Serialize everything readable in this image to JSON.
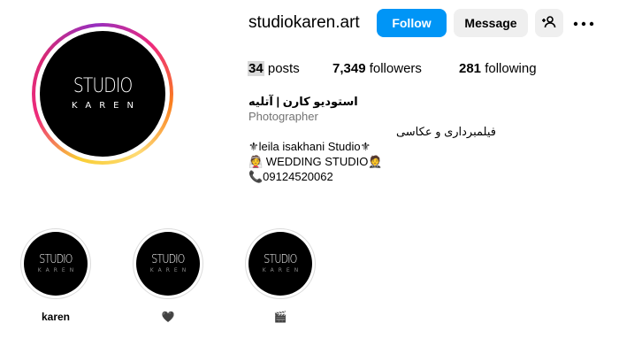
{
  "profile": {
    "username": "studiokaren.art",
    "avatar_logo_main": "STUDIO",
    "avatar_logo_sub": "KAREN",
    "follow_label": "Follow",
    "message_label": "Message",
    "suggest_icon": "person-add-icon",
    "more_icon": "more-horizontal-icon",
    "follow_color": "#0095f6"
  },
  "stats": {
    "posts_count": "34",
    "posts_label": "posts",
    "followers_count": "7,349",
    "followers_label": "followers",
    "following_count": "281",
    "following_label": "following"
  },
  "bio": {
    "name": "استودیو کارن | آتلیه",
    "category": "Photographer",
    "line1": "فیلمبرداری و عکاسی",
    "line2": "⚜leila isakhani Studio⚜",
    "line3": "👰 WEDDING STUDIO🤵",
    "line4": "📞09124520062"
  },
  "highlights": [
    {
      "label": "karen",
      "logo_main": "STUDIO",
      "logo_sub": "KAREN"
    },
    {
      "label": "🖤",
      "logo_main": "STUDIO",
      "logo_sub": "KAREN"
    },
    {
      "label": "🎬",
      "logo_main": "STUDIO",
      "logo_sub": "KAREN"
    }
  ]
}
